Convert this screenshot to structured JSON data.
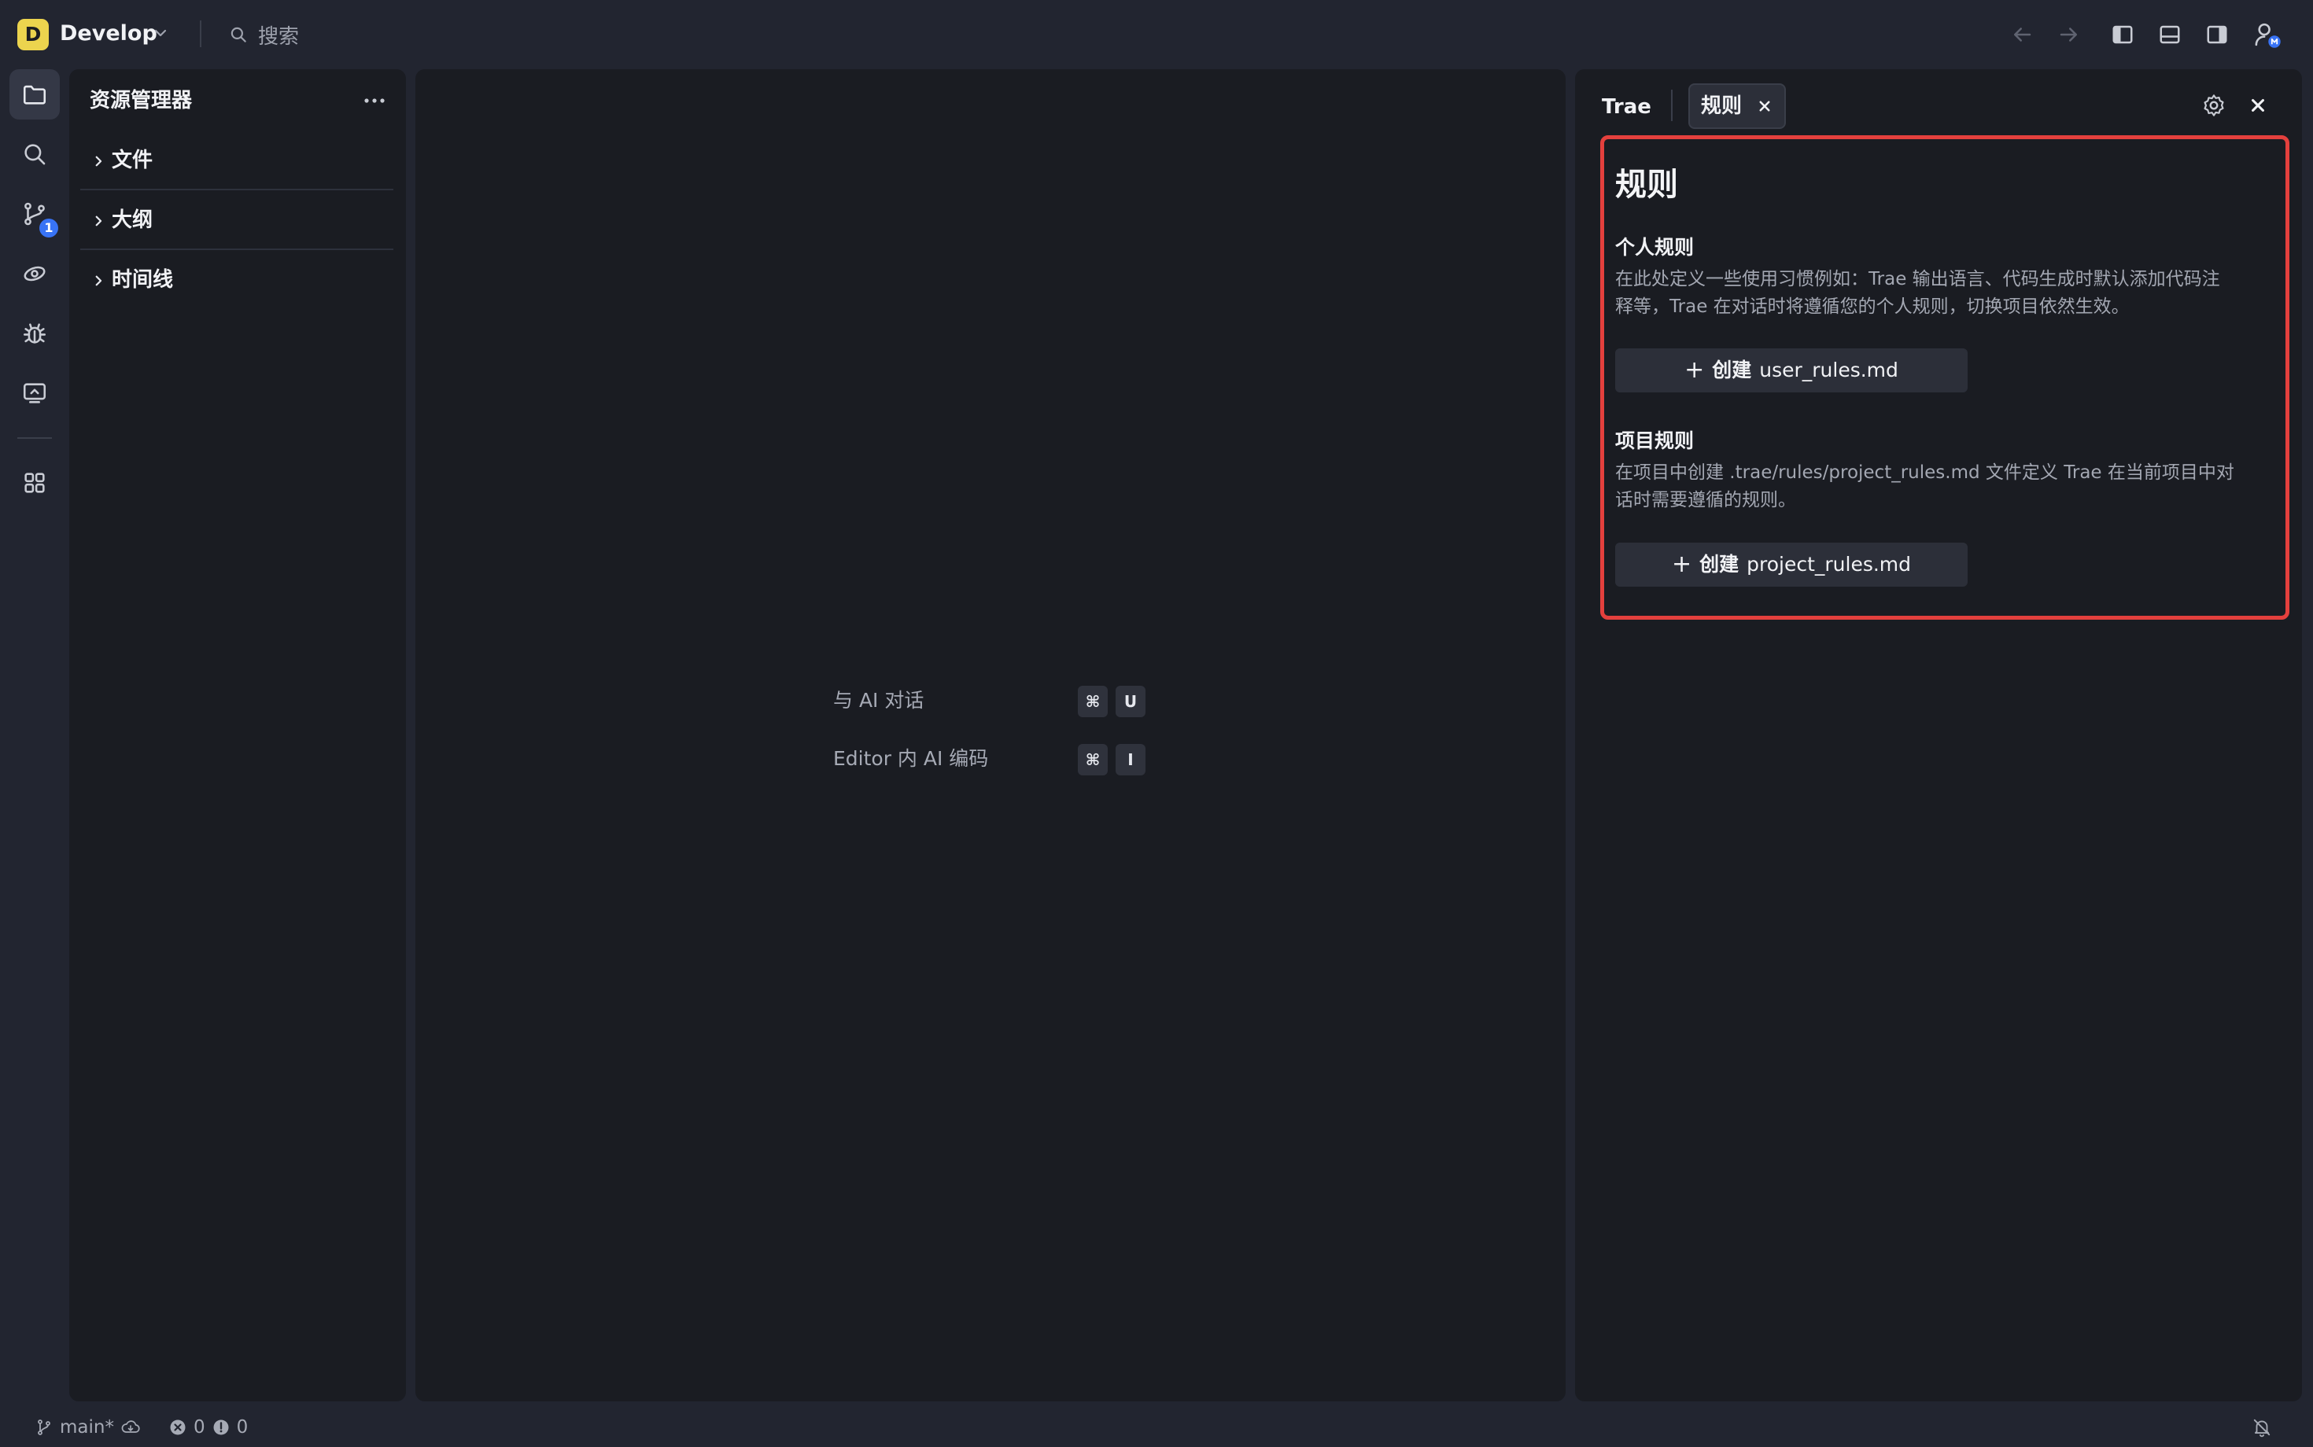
{
  "titlebar": {
    "workspace_initial": "D",
    "workspace_name": "Develop",
    "search_placeholder": "搜索"
  },
  "activity_bar": {
    "scm_badge": "1"
  },
  "explorer": {
    "title": "资源管理器",
    "sections": [
      {
        "label": "文件"
      },
      {
        "label": "大纲"
      },
      {
        "label": "时间线"
      }
    ]
  },
  "editor": {
    "shortcuts": [
      {
        "label": "与 AI 对话",
        "keys": [
          "⌘",
          "U"
        ]
      },
      {
        "label": "Editor 内 AI 编码",
        "keys": [
          "⌘",
          "I"
        ]
      }
    ]
  },
  "right_panel": {
    "tabs": [
      {
        "label": "Trae",
        "active": false
      },
      {
        "label": "规则",
        "active": true,
        "closable": true
      }
    ],
    "rules": {
      "title": "规则",
      "personal": {
        "heading": "个人规则",
        "desc_line1": "在此处定义一些使用习惯例如：Trae 输出语言、代码生成时默认添加代码注",
        "desc_line2": "释等，Trae 在对话时将遵循您的个人规则，切换项目依然生效。",
        "button_prefix": "创建",
        "button_file": "user_rules.md"
      },
      "project": {
        "heading": "项目规则",
        "desc_line1": "在项目中创建 .trae/rules/project_rules.md 文件定义 Trae 在当前项目中对",
        "desc_line2": "话时需要遵循的规则。",
        "button_prefix": "创建",
        "button_file": "project_rules.md"
      }
    }
  },
  "statusbar": {
    "branch": "main*",
    "errors": "0",
    "warnings": "0"
  },
  "colors": {
    "highlight_border": "#e4403d",
    "workspace_badge": "#ecd44e",
    "badge_blue": "#3873f5"
  }
}
